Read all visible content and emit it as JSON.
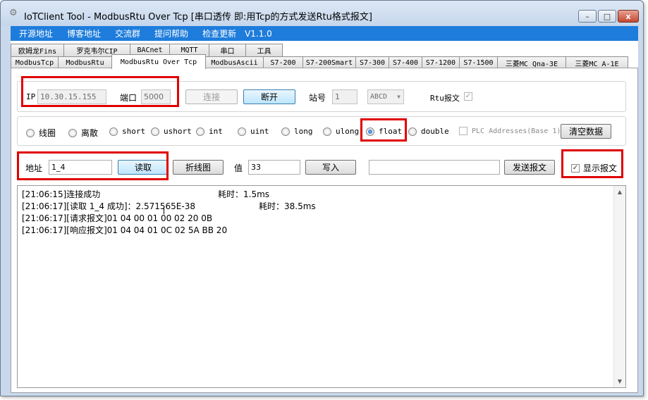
{
  "window": {
    "title": "IoTClient Tool - ModbusRtu Over Tcp [串口透传 即:用Tcp的方式发送Rtu格式报文]",
    "minimize_glyph": "–",
    "maximize_glyph": "□",
    "close_glyph": "x"
  },
  "menu": {
    "items": [
      "开源地址",
      "博客地址",
      "交流群",
      "提问帮助",
      "检查更新"
    ],
    "version": "V1.1.0"
  },
  "tabs": {
    "row1": [
      "欧姆龙Fins",
      "罗克韦尔CIP",
      "BACnet",
      "MQTT",
      "串口",
      "工具"
    ],
    "row2": [
      "ModbusTcp",
      "ModbusRtu",
      "ModbusRtu Over Tcp",
      "ModbusAscii",
      "S7-200",
      "S7-200Smart",
      "S7-300",
      "S7-400",
      "S7-1200",
      "S7-1500",
      "三菱MC Qna-3E",
      "三菱MC A-1E"
    ],
    "active": "ModbusRtu Over Tcp"
  },
  "connection": {
    "ip_label": "IP",
    "ip_value": "10.30.15.155",
    "port_label": "端口",
    "port_value": "5000",
    "connect_label": "连接",
    "disconnect_label": "断开",
    "station_label": "站号",
    "station_value": "1",
    "byte_order": "ABCD",
    "rtu_label": "Rtu报文",
    "rtu_checked": true
  },
  "datatypes": {
    "items": [
      "线圈",
      "离散",
      "short",
      "ushort",
      "int",
      "uint",
      "long",
      "ulong",
      "float",
      "double"
    ],
    "selected": "float",
    "plc_addresses_label": "PLC Addresses(Base 1)",
    "clear_label": "清空数据"
  },
  "operation": {
    "address_label": "地址",
    "address_value": "1_4",
    "read_label": "读取",
    "chart_label": "折线图",
    "value_label": "值",
    "value_value": "33",
    "write_label": "写入",
    "send_label": "发送报文",
    "show_packet_label": "显示报文",
    "show_packet_checked": true
  },
  "log": {
    "lines": [
      {
        "text": "[21:06:15]连接成功",
        "time": "耗时：1.5ms"
      },
      {
        "text": "[21:06:17][读取 1_4 成功]：2.571565E-38",
        "time": "耗时：38.5ms"
      },
      {
        "text": "[21:06:17][请求报文]01 04 00 01 00 02 20 0B",
        "time": ""
      },
      {
        "text": "[21:06:17][响应报文]01 04 04 01 0C 02 5A BB 20",
        "time": ""
      }
    ]
  },
  "colors": {
    "menu_bg": "#1e7ddc",
    "highlight": "#e00000",
    "window_frame": "#c9d8ec"
  },
  "icons": {
    "app": "gear-icon",
    "check": "checkmark-icon",
    "scroll_up": "arrow-up-icon",
    "scroll_down": "arrow-down-icon"
  }
}
